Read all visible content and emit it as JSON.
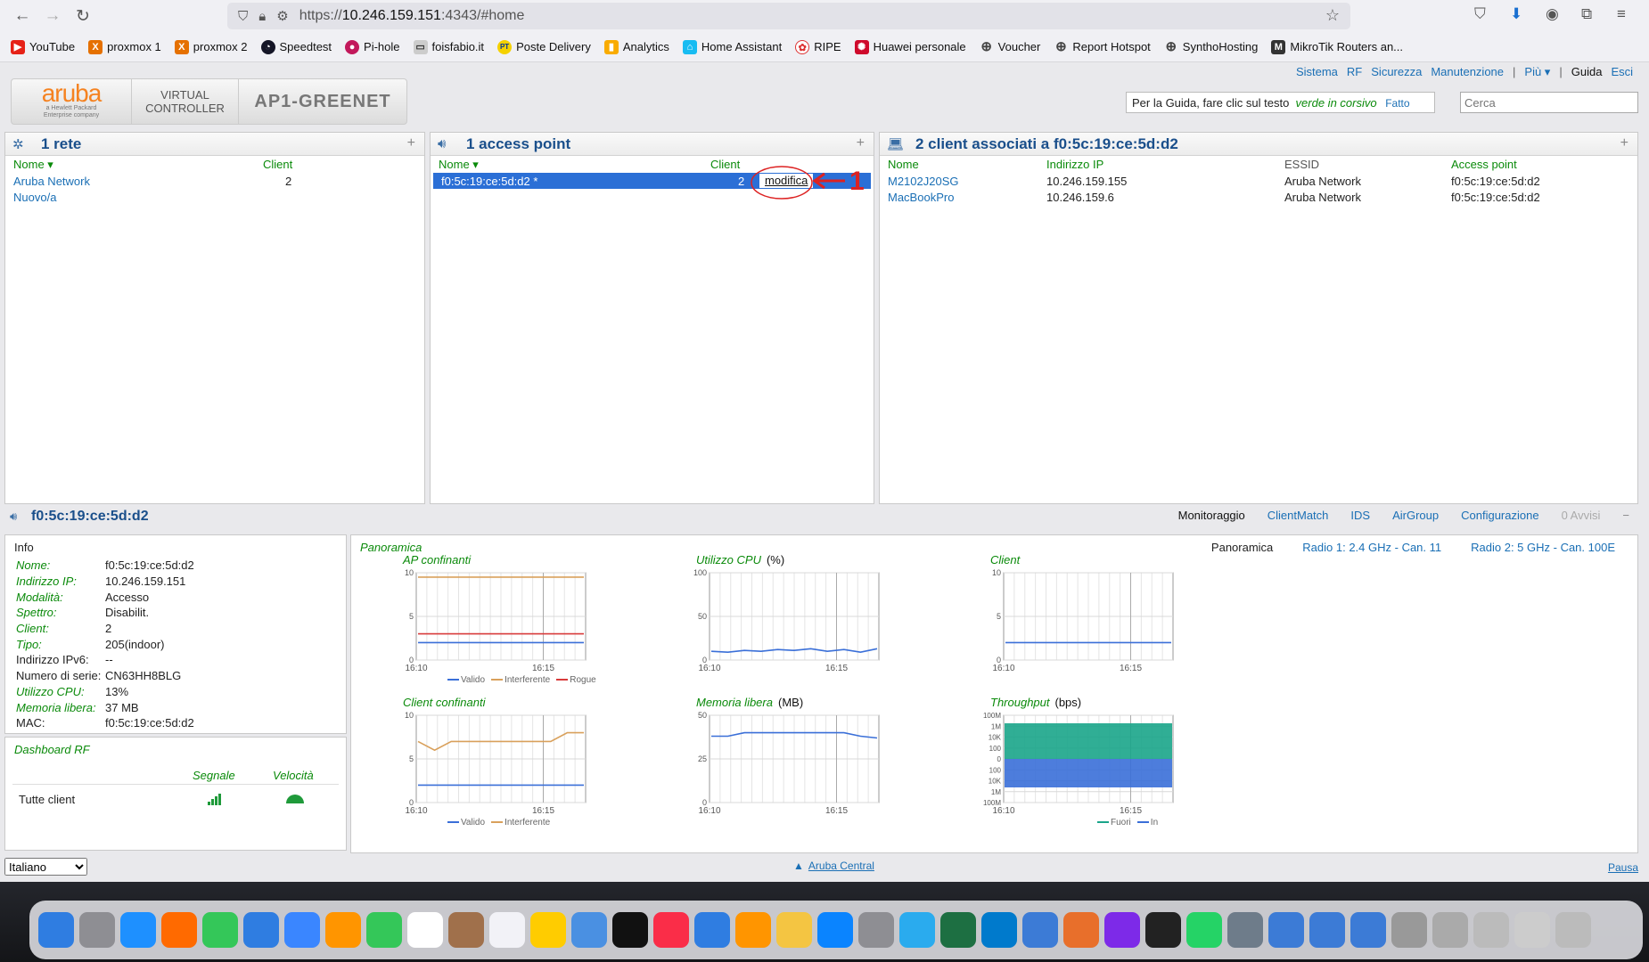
{
  "browser": {
    "url_prefix": "https://",
    "url_host": "10.246.159.151",
    "url_suffix": ":4343/#home",
    "bookmarks": [
      "YouTube",
      "proxmox 1",
      "proxmox 2",
      "Speedtest",
      "Pi-hole",
      "foisfabio.it",
      "Poste Delivery",
      "Analytics",
      "Home Assistant",
      "RIPE",
      "Huawei personale",
      "Voucher",
      "Report Hotspot",
      "SynthoHosting",
      "MikroTik Routers an..."
    ]
  },
  "header": {
    "logo_word": "aruba",
    "logo_sub1": "a Hewlett Packard",
    "logo_sub2": "Enterprise company",
    "vc_line1": "VIRTUAL",
    "vc_line2": "CONTROLLER",
    "vc_name": "AP1-GREENET",
    "links": [
      "Sistema",
      "RF",
      "Sicurezza",
      "Manutenzione",
      "|",
      "Più ▾",
      "|",
      "Guida",
      "Esci"
    ],
    "help_text": "Per la Guida, fare clic sul testo",
    "help_green": "verde in corsivo",
    "help_done": "Fatto",
    "search_placeholder": "Cerca"
  },
  "networks": {
    "title": "1 rete",
    "col_name": "Nome",
    "col_client": "Client",
    "rows": [
      {
        "name": "Aruba Network",
        "client": "2"
      },
      {
        "name": "Nuovo/a",
        "client": ""
      }
    ]
  },
  "access_points": {
    "title": "1 access point",
    "col_name": "Nome",
    "col_client": "Client",
    "row": {
      "name": "f0:5c:19:ce:5d:d2 *",
      "client": "2",
      "action": "modifica"
    },
    "annotation": "1"
  },
  "clients": {
    "title": "2 client associati a f0:5c:19:ce:5d:d2",
    "cols": [
      "Nome",
      "Indirizzo IP",
      "ESSID",
      "Access point"
    ],
    "rows": [
      [
        "M2102J20SG",
        "10.246.159.155",
        "Aruba Network",
        "f0:5c:19:ce:5d:d2"
      ],
      [
        "MacBookPro",
        "10.246.159.6",
        "Aruba Network",
        "f0:5c:19:ce:5d:d2"
      ]
    ]
  },
  "ap_detail": {
    "title": "f0:5c:19:ce:5d:d2",
    "tabs": [
      "Monitoraggio",
      "ClientMatch",
      "IDS",
      "AirGroup",
      "Configurazione",
      "0 Avvisi"
    ],
    "info_title": "Info",
    "info": [
      {
        "k": "Nome:",
        "v": "f0:5c:19:ce:5d:d2",
        "green": true
      },
      {
        "k": "Indirizzo IP:",
        "v": "10.246.159.151",
        "green": true
      },
      {
        "k": "Modalità:",
        "v": "Accesso",
        "green": true
      },
      {
        "k": "Spettro:",
        "v": "Disabilit.",
        "green": true
      },
      {
        "k": "Client:",
        "v": "2",
        "green": true
      },
      {
        "k": "Tipo:",
        "v": "205(indoor)",
        "green": true
      },
      {
        "k": "Indirizzo IPv6:",
        "v": "--",
        "green": false
      },
      {
        "k": "Numero di serie:",
        "v": "CN63HH8BLG",
        "green": false
      },
      {
        "k": "Utilizzo CPU:",
        "v": "13%",
        "green": true
      },
      {
        "k": "Memoria libera:",
        "v": "37 MB",
        "green": true
      },
      {
        "k": "MAC:",
        "v": "f0:5c:19:ce:5d:d2",
        "green": false
      }
    ],
    "rf_title": "Dashboard RF",
    "rf_col_signal": "Segnale",
    "rf_col_speed": "Velocità",
    "rf_row": "Tutte client",
    "overview_title": "Panoramica",
    "overview_tabs": [
      "Panoramica",
      "Radio 1: 2.4 GHz - Can. 11",
      "Radio 2: 5 GHz - Can. 100E"
    ]
  },
  "chart_data": [
    {
      "type": "line",
      "title": "AP confinanti",
      "unit": "",
      "yticks": [
        "10",
        "5",
        "0"
      ],
      "xticks": [
        "16:10",
        "16:15"
      ],
      "ylim": [
        0,
        10
      ],
      "series": [
        {
          "name": "Valido",
          "color": "#3a6fd8",
          "values": [
            2,
            2,
            2,
            2,
            2,
            2,
            2,
            2
          ]
        },
        {
          "name": "Interferente",
          "color": "#d9a05b",
          "values": [
            9.5,
            9.5,
            9.5,
            9.5,
            9.5,
            9.5,
            9.5,
            9.5
          ]
        },
        {
          "name": "Rogue",
          "color": "#d83a3a",
          "values": [
            3,
            3,
            3,
            3,
            3,
            3,
            3,
            3
          ]
        }
      ]
    },
    {
      "type": "line",
      "title": "Utilizzo CPU",
      "unit": "(%)",
      "yticks": [
        "100",
        "50",
        "0"
      ],
      "xticks": [
        "16:10",
        "16:15"
      ],
      "ylim": [
        0,
        100
      ],
      "series": [
        {
          "name": "",
          "color": "#3a6fd8",
          "values": [
            10,
            9,
            11,
            10,
            12,
            11,
            13,
            10,
            12,
            9,
            13
          ]
        }
      ]
    },
    {
      "type": "line",
      "title": "Client",
      "unit": "",
      "yticks": [
        "10",
        "5",
        "0"
      ],
      "xticks": [
        "16:10",
        "16:15"
      ],
      "ylim": [
        0,
        10
      ],
      "series": [
        {
          "name": "",
          "color": "#3a6fd8",
          "values": [
            2,
            2,
            2,
            2,
            2,
            2,
            2,
            2
          ]
        }
      ]
    },
    {
      "type": "line",
      "title": "Client confinanti",
      "unit": "",
      "yticks": [
        "10",
        "5",
        "0"
      ],
      "xticks": [
        "16:10",
        "16:15"
      ],
      "ylim": [
        0,
        10
      ],
      "series": [
        {
          "name": "Valido",
          "color": "#3a6fd8",
          "values": [
            2,
            2,
            2,
            2,
            2,
            2,
            2,
            2,
            2,
            2
          ]
        },
        {
          "name": "Interferente",
          "color": "#d9a05b",
          "values": [
            7,
            6,
            7,
            7,
            7,
            7,
            7,
            7,
            7,
            8,
            8
          ]
        }
      ]
    },
    {
      "type": "line",
      "title": "Memoria libera",
      "unit": "(MB)",
      "yticks": [
        "50",
        "25",
        "0"
      ],
      "xticks": [
        "16:10",
        "16:15"
      ],
      "ylim": [
        0,
        50
      ],
      "series": [
        {
          "name": "",
          "color": "#3a6fd8",
          "values": [
            38,
            38,
            40,
            40,
            40,
            40,
            40,
            40,
            40,
            38,
            37
          ]
        }
      ]
    },
    {
      "type": "area",
      "title": "Throughput",
      "unit": "(bps)",
      "yticks": [
        "100M",
        "1M",
        "10K",
        "100",
        "0",
        "100",
        "10K",
        "1M",
        "100M"
      ],
      "xticks": [
        "16:10",
        "16:15"
      ],
      "series": [
        {
          "name": "Fuori",
          "color": "#1aa58a"
        },
        {
          "name": "In",
          "color": "#3a6fd8"
        }
      ]
    }
  ],
  "footer": {
    "language": "Italiano",
    "central": "Aruba Central",
    "pause": "Pausa"
  }
}
